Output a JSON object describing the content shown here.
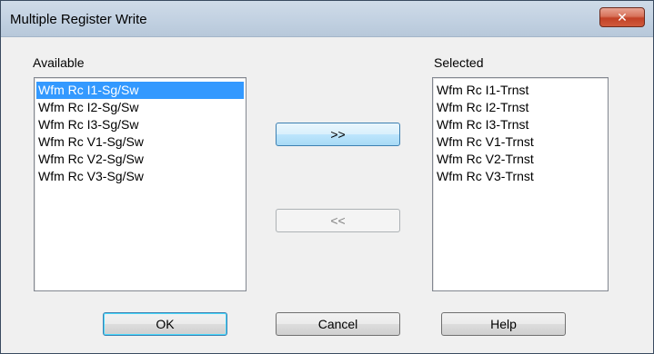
{
  "window": {
    "title": "Multiple Register Write",
    "close_glyph": "✕"
  },
  "available": {
    "label": "Available",
    "items": [
      "Wfm Rc I1-Sg/Sw",
      "Wfm Rc I2-Sg/Sw",
      "Wfm Rc I3-Sg/Sw",
      "Wfm Rc V1-Sg/Sw",
      "Wfm Rc V2-Sg/Sw",
      "Wfm Rc V3-Sg/Sw"
    ],
    "selected_index": 0
  },
  "selected": {
    "label": "Selected",
    "items": [
      "Wfm Rc I1-Trnst",
      "Wfm Rc I2-Trnst",
      "Wfm Rc I3-Trnst",
      "Wfm Rc V1-Trnst",
      "Wfm Rc V2-Trnst",
      "Wfm Rc V3-Trnst"
    ]
  },
  "buttons": {
    "add": ">>",
    "remove": "<<",
    "ok": "OK",
    "cancel": "Cancel",
    "help": "Help"
  },
  "colors": {
    "selection": "#3399ff",
    "close_button": "#c24126"
  },
  "icons": {
    "close": "close-icon"
  }
}
